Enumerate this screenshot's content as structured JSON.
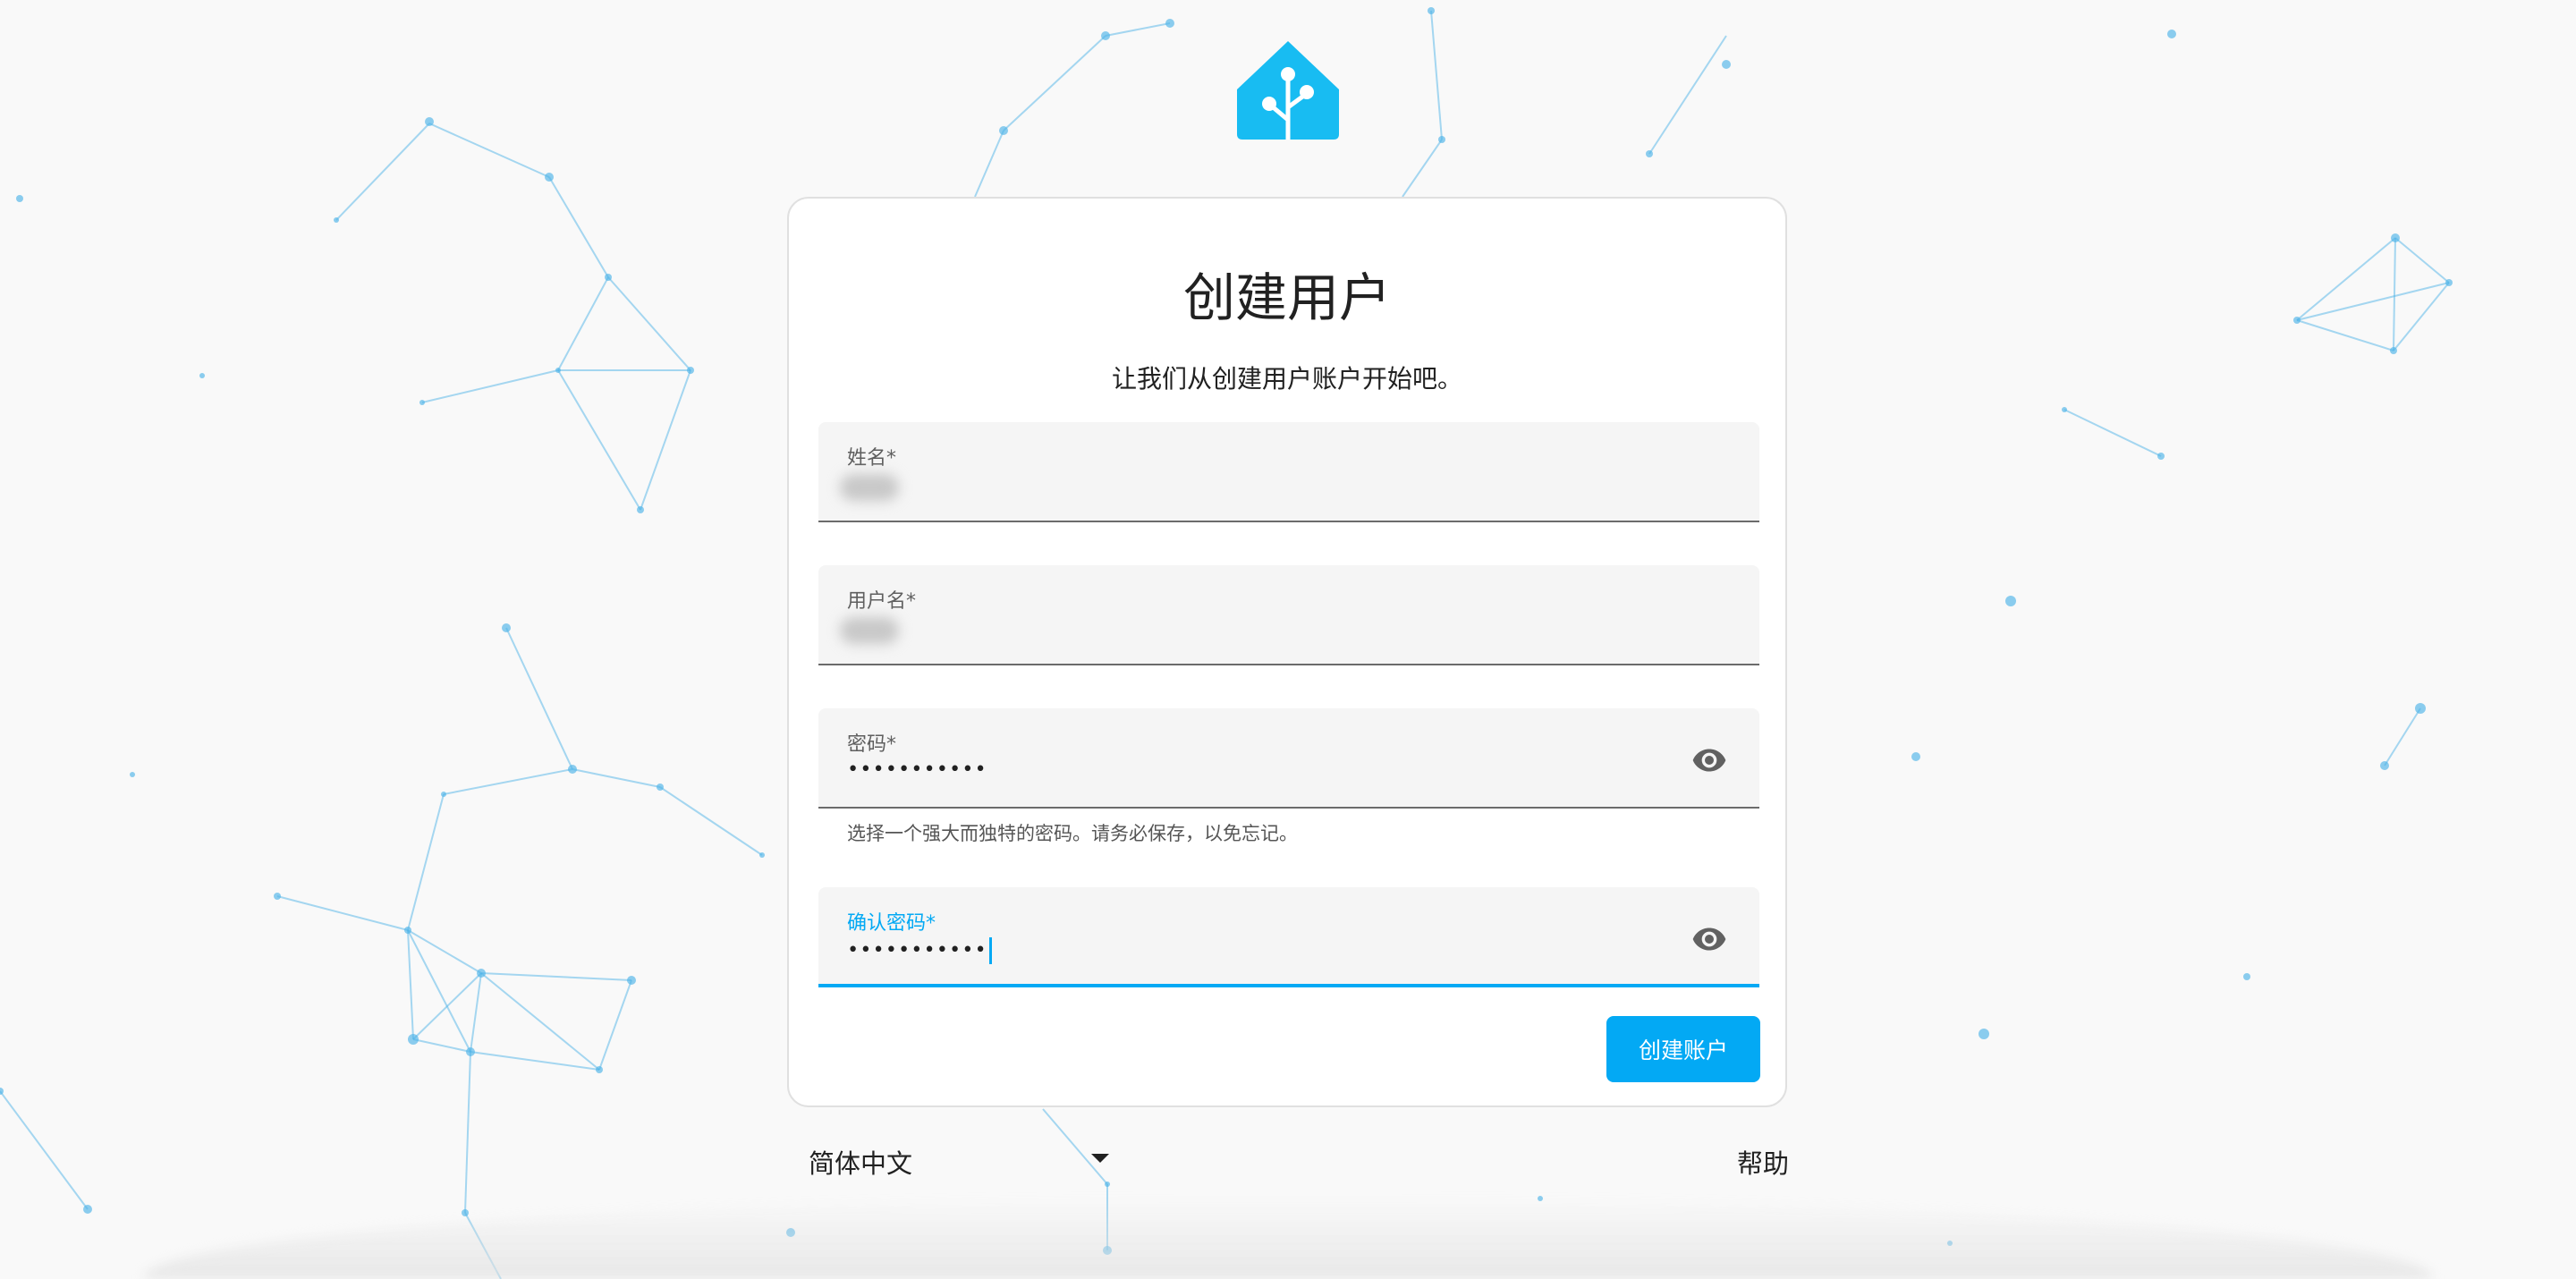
{
  "colors": {
    "accent": "#03a9f4",
    "network_line": "#4fb3e8",
    "background": "#f9f9f9"
  },
  "logo": {
    "icon": "home-assistant-logo-icon"
  },
  "card": {
    "title": "创建用户",
    "subtitle": "让我们从创建用户账户开始吧。"
  },
  "fields": {
    "name": {
      "label": "姓名*",
      "value_blurred": true
    },
    "username": {
      "label": "用户名*",
      "value_blurred": true
    },
    "password": {
      "label": "密码*",
      "value": "•••••••••••",
      "helper": "选择一个强大而独特的密码。请务必保存，以免忘记。",
      "icon": "eye-icon"
    },
    "confirm_password": {
      "label": "确认密码*",
      "value": "•••••••••••",
      "focused": true,
      "icon": "eye-icon"
    }
  },
  "submit_label": "创建账户",
  "footer": {
    "language": "简体中文",
    "language_icon": "caret-down-icon",
    "help": "帮助"
  }
}
